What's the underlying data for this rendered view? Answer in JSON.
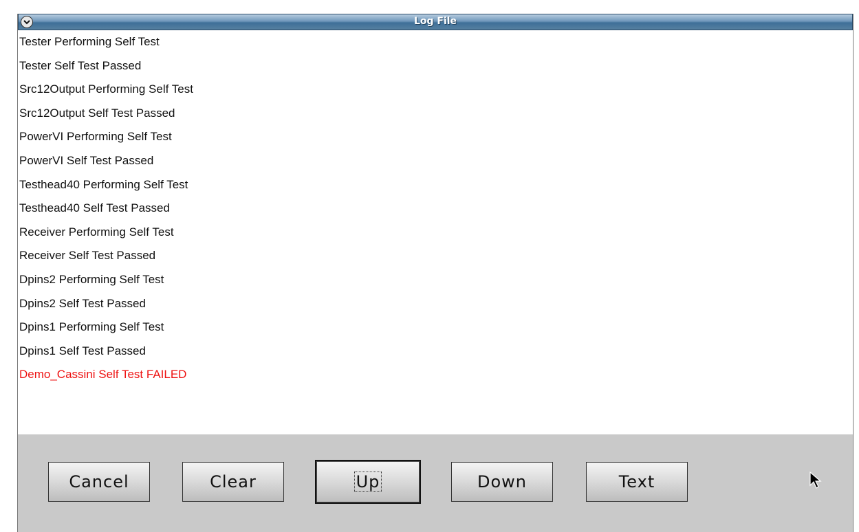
{
  "window": {
    "title": "Log File"
  },
  "log": {
    "lines": [
      {
        "text": "Tester  Performing Self Test",
        "error": false
      },
      {
        "text": "Tester Self Test Passed",
        "error": false
      },
      {
        "text": "Src12Output  Performing Self Test",
        "error": false
      },
      {
        "text": "Src12Output Self Test Passed",
        "error": false
      },
      {
        "text": "PowerVI  Performing Self Test",
        "error": false
      },
      {
        "text": "PowerVI Self Test Passed",
        "error": false
      },
      {
        "text": "Testhead40  Performing Self Test",
        "error": false
      },
      {
        "text": "Testhead40 Self Test Passed",
        "error": false
      },
      {
        "text": "Receiver  Performing Self Test",
        "error": false
      },
      {
        "text": "Receiver Self Test Passed",
        "error": false
      },
      {
        "text": "Dpins2  Performing Self Test",
        "error": false
      },
      {
        "text": "Dpins2 Self Test Passed",
        "error": false
      },
      {
        "text": "Dpins1  Performing Self Test",
        "error": false
      },
      {
        "text": "Dpins1 Self Test Passed",
        "error": false
      },
      {
        "text": "Demo_Cassini Self Test FAILED",
        "error": true
      }
    ]
  },
  "buttons": {
    "cancel": "Cancel",
    "clear": "Clear",
    "up": "Up",
    "down": "Down",
    "text": "Text"
  },
  "colors": {
    "error_text": "#ee1111",
    "titlebar": "#557f9f",
    "footer": "#c9c9c9"
  },
  "icons": {
    "window_menu": "chevron-down-icon",
    "pointer": "mouse-pointer-icon"
  }
}
